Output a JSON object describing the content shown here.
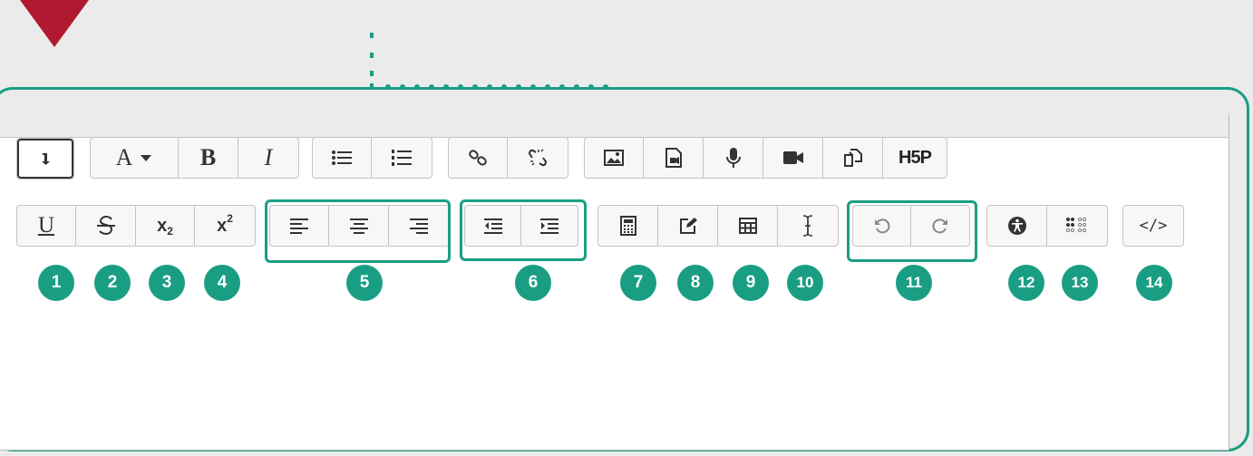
{
  "toolbar_row1": {
    "font_label": "A",
    "bold_label": "B",
    "italic_label": "I",
    "h5p_label": "H5P"
  },
  "toolbar_row2": {
    "underline_label": "U",
    "subscript_label": "x",
    "subscript_suffix": "2",
    "superscript_label": "x",
    "superscript_suffix": "2",
    "html_label": "</>"
  },
  "markers": [
    "1",
    "2",
    "3",
    "4",
    "5",
    "6",
    "7",
    "8",
    "9",
    "10",
    "11",
    "12",
    "13",
    "14"
  ],
  "colors": {
    "accent": "#1a9e83",
    "pointer": "#b0192f"
  }
}
